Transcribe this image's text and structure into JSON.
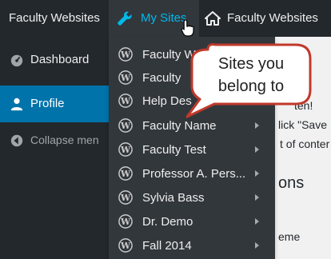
{
  "adminbar": {
    "brand_label": "Faculty Websites",
    "mysites_label": "My Sites",
    "right_label": "Faculty Websites"
  },
  "sidebar": {
    "items": [
      {
        "label": "Dashboard",
        "icon": "dashboard-icon"
      },
      {
        "label": "Profile",
        "icon": "user-icon"
      },
      {
        "label": "Collapse men",
        "icon": "collapse-icon"
      }
    ]
  },
  "dropdown": {
    "items": [
      {
        "label": "Faculty W"
      },
      {
        "label": "Faculty"
      },
      {
        "label": "Help Des"
      },
      {
        "label": "Faculty Name"
      },
      {
        "label": "Faculty Test"
      },
      {
        "label": "Professor A. Pers..."
      },
      {
        "label": "Sylvia Bass"
      },
      {
        "label": "Dr. Demo"
      },
      {
        "label": "Fall 2014"
      }
    ]
  },
  "content": {
    "line1": "ten!",
    "line2": "lick \"Save",
    "line3": "t of conter",
    "heading": "ons",
    "line4": "eme"
  },
  "callout": {
    "line1": "Sites you",
    "line2": "belong to"
  },
  "colors": {
    "adminbar_bg": "#23282d",
    "dropdown_bg": "#32373c",
    "accent_blue": "#00b9eb",
    "active_nav": "#0073aa",
    "callout_fill": "#ffffff",
    "callout_stroke": "#c0392b"
  }
}
